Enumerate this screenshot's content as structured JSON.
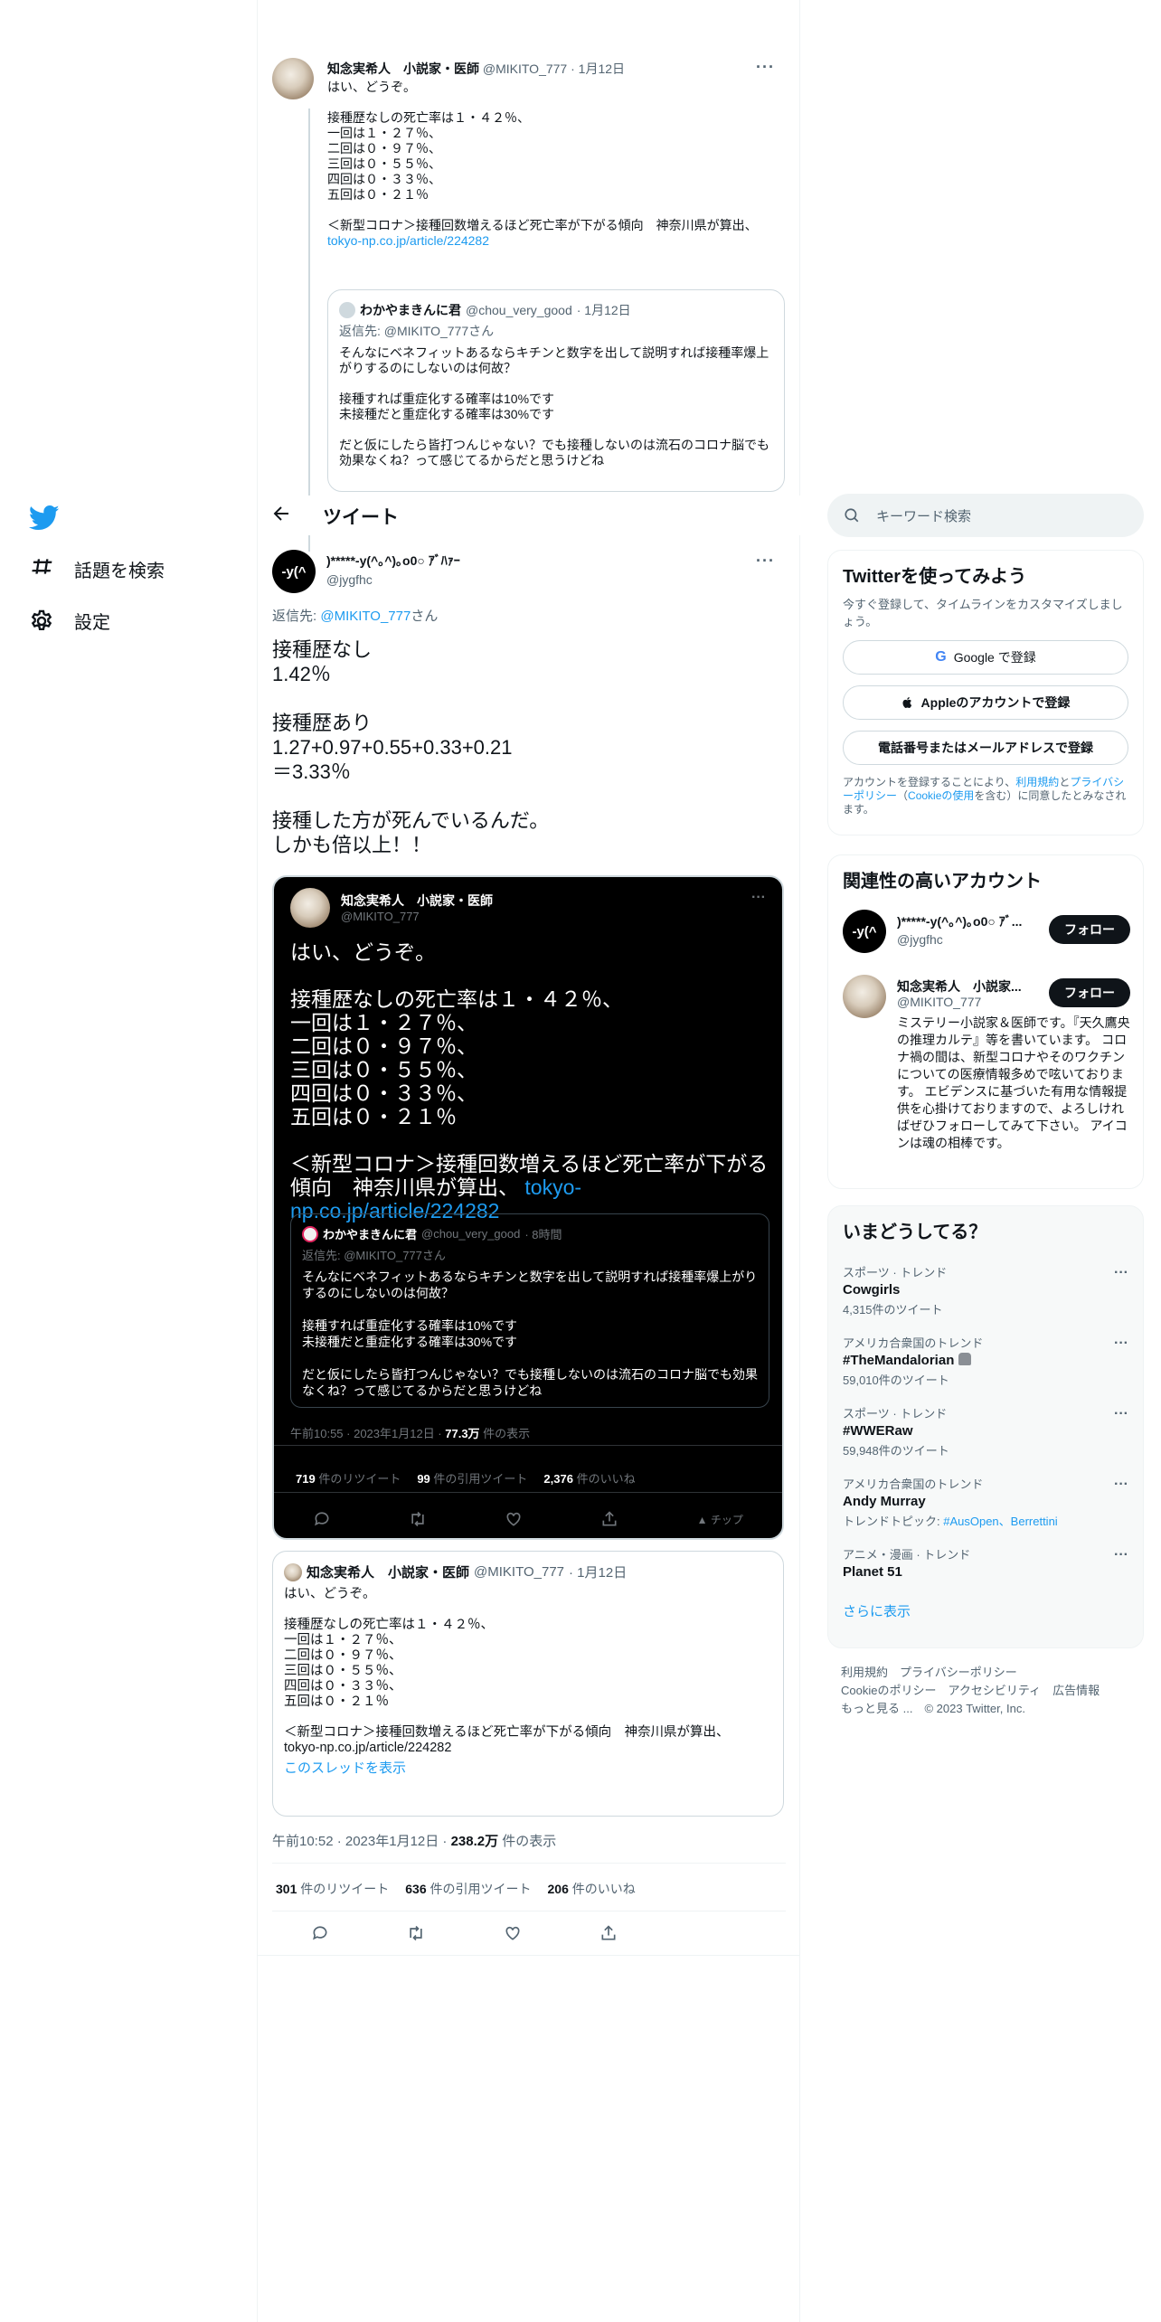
{
  "nav": {
    "items": [
      {
        "label": "話題を検索",
        "icon": "hash-icon"
      },
      {
        "label": "設定",
        "icon": "gear-icon"
      }
    ]
  },
  "header": {
    "title": "ツイート"
  },
  "context_tweet": {
    "author_name": "知念実希人　小説家・医師",
    "handle": "@MIKITO_777",
    "date": "· 1月12日",
    "text": "はい、どうぞ。\n\n接種歴なしの死亡率は１・４２％、\n一回は１・２７％、\n二回は０・９７％、\n三回は０・５５％、\n四回は０・３３％、\n五回は０・２１％\n\n＜新型コロナ＞接種回数増えるほど死亡率が下がる傾向　神奈川県が算出、",
    "link": "tokyo-np.co.jp/article/224282",
    "quote": {
      "author_name": "わかやまきんに君",
      "handle": "@chou_very_good",
      "date": "· 1月12日",
      "reply_to": "返信先: @MIKITO_777さん",
      "text": "そんなにベネフィットあるならキチンと数字を出して説明すれば接種率爆上がりするのにしないのは何故？\n\n接種すれば重症化する確率は10%です\n未接種だと重症化する確率は30%です\n\nだと仮にしたら皆打つんじゃない？でも接種しないのは流石のコロナ脳でも効果なくね？って感じてるからだと思うけどね"
    }
  },
  "main_tweet": {
    "avatar_text": "-y(^",
    "author_name": ")*****-y(^｡^)｡o0○ ｱﾞﾊｧｰ",
    "handle": "@jygfhc",
    "reply_prefix": "返信先: ",
    "reply_handle": "@MIKITO_777",
    "reply_suffix": "さん",
    "text": "接種歴なし\n1.42％\n\n接種歴あり\n1.27+0.97+0.55+0.33+0.21\n＝3.33％\n\n接種した方が死んでいるんだ。\nしかも倍以上！！",
    "meta_time": "午前10:52 · 2023年1月12日 · ",
    "views": "238.2万",
    "views_label": " 件の表示",
    "retweets": "301",
    "retweets_label": " 件のリツイート",
    "quotes": "636",
    "quotes_label": " 件の引用ツイート",
    "likes": "206",
    "likes_label": " 件のいいね"
  },
  "screenshot_image": {
    "author_name": "知念実希人　小説家・医師",
    "handle": "@MIKITO_777",
    "text": "はい、どうぞ。\n\n接種歴なしの死亡率は１・４２％、\n一回は１・２７％、\n二回は０・９７％、\n三回は０・５５％、\n四回は０・３３％、\n五回は０・２１％\n\n＜新型コロナ＞接種回数増えるほど死亡率が下がる傾向　神奈川県が算出、",
    "link": "tokyo-np.co.jp/article/224282",
    "quote": {
      "author_name": "わかやまきんに君",
      "handle": "@chou_very_good",
      "date": "· 8時間",
      "reply_to": "返信先: @MIKITO_777さん",
      "text": "そんなにベネフィットあるならキチンと数字を出して説明すれば接種率爆上がりするのにしないのは何故？\n\n接種すれば重症化する確率は10%です\n未接種だと重症化する確率は30%です\n\nだと仮にしたら皆打つんじゃない？でも接種しないのは流石のコロナ脳でも効果なくね？って感じてるからだと思うけどね"
    },
    "meta_time": "午前10:55 · 2023年1月12日 · ",
    "views": "77.3万",
    "views_label": " 件の表示",
    "retweets": "719",
    "retweets_label": " 件のリツイート",
    "quotes": "99",
    "quotes_label": " 件の引用ツイート",
    "likes": "2,376",
    "likes_label": " 件のいいね",
    "tip_label": "チップ"
  },
  "quoted_tweet": {
    "author_name": "知念実希人　小説家・医師",
    "handle": "@MIKITO_777",
    "date": "· 1月12日",
    "text": "はい、どうぞ。\n\n接種歴なしの死亡率は１・４２％、\n一回は１・２７％、\n二回は０・９７％、\n三回は０・５５％、\n四回は０・３３％、\n五回は０・２１％\n\n＜新型コロナ＞接種回数増えるほど死亡率が下がる傾向　神奈川県が算出、\ntokyo-np.co.jp/article/224282",
    "show_thread": "このスレッドを表示"
  },
  "sidebar": {
    "search_placeholder": "キーワード検索",
    "signup": {
      "title": "Twitterを使ってみよう",
      "subtitle": "今すぐ登録して、タイムラインをカスタマイズしましょう。",
      "google": "Google で登録",
      "apple": "Appleのアカウントで登録",
      "phone": "電話番号またはメールアドレスで登録",
      "terms_1": "アカウントを登録することにより、",
      "terms_link1": "利用規約",
      "terms_2": "と",
      "terms_link2": "プライバシーポリシー",
      "terms_3": "（",
      "terms_link3": "Cookieの使用",
      "terms_4": "を含む）に同意したとみなされます。"
    },
    "related": {
      "title": "関連性の高いアカウント",
      "accounts": [
        {
          "name": ")*****-y(^｡^)｡o0○ ｱﾞ...",
          "handle": "@jygfhc",
          "follow": "フォロー",
          "avatar_text": "-y(^",
          "bio": ""
        },
        {
          "name": "知念実希人　小説家...",
          "handle": "@MIKITO_777",
          "follow": "フォロー",
          "avatar_text": "",
          "bio": "ミステリー小説家＆医師です。『天久鷹央の推理カルテ』等を書いています。 コロナ禍の間は、新型コロナやそのワクチンについての医療情報多めで呟いております。 エビデンスに基づいた有用な情報提供を心掛けておりますので、よろしければぜひフォローしてみて下さい。 アイコンは魂の相棒です。"
        }
      ]
    },
    "trends": {
      "title": "いまどうしてる？",
      "items": [
        {
          "category": "スポーツ · トレンド",
          "name": "Cowgirls",
          "count": "4,315件のツイート"
        },
        {
          "category": "アメリカ合衆国のトレンド",
          "name": "#TheMandalorian",
          "count": "59,010件のツイート"
        },
        {
          "category": "スポーツ · トレンド",
          "name": "#WWERaw",
          "count": "59,948件のツイート"
        },
        {
          "category": "アメリカ合衆国のトレンド",
          "name": "Andy Murray",
          "count_prefix": "トレンドトピック: ",
          "count_link": "#AusOpen、Berrettini"
        },
        {
          "category": "アニメ・漫画 · トレンド",
          "name": "Planet 51"
        }
      ],
      "show_more": "さらに表示"
    },
    "footer": {
      "links_1": [
        "利用規約",
        "プライバシーポリシー"
      ],
      "links_2": [
        "Cookieのポリシー",
        "アクセシビリティ",
        "広告情報"
      ],
      "more": "もっと見る ...",
      "copyright": "© 2023 Twitter, Inc."
    }
  },
  "colors": {
    "accent": "#1d9bf0",
    "text": "#0f1419",
    "muted": "#536471",
    "border": "#cfd9de"
  }
}
